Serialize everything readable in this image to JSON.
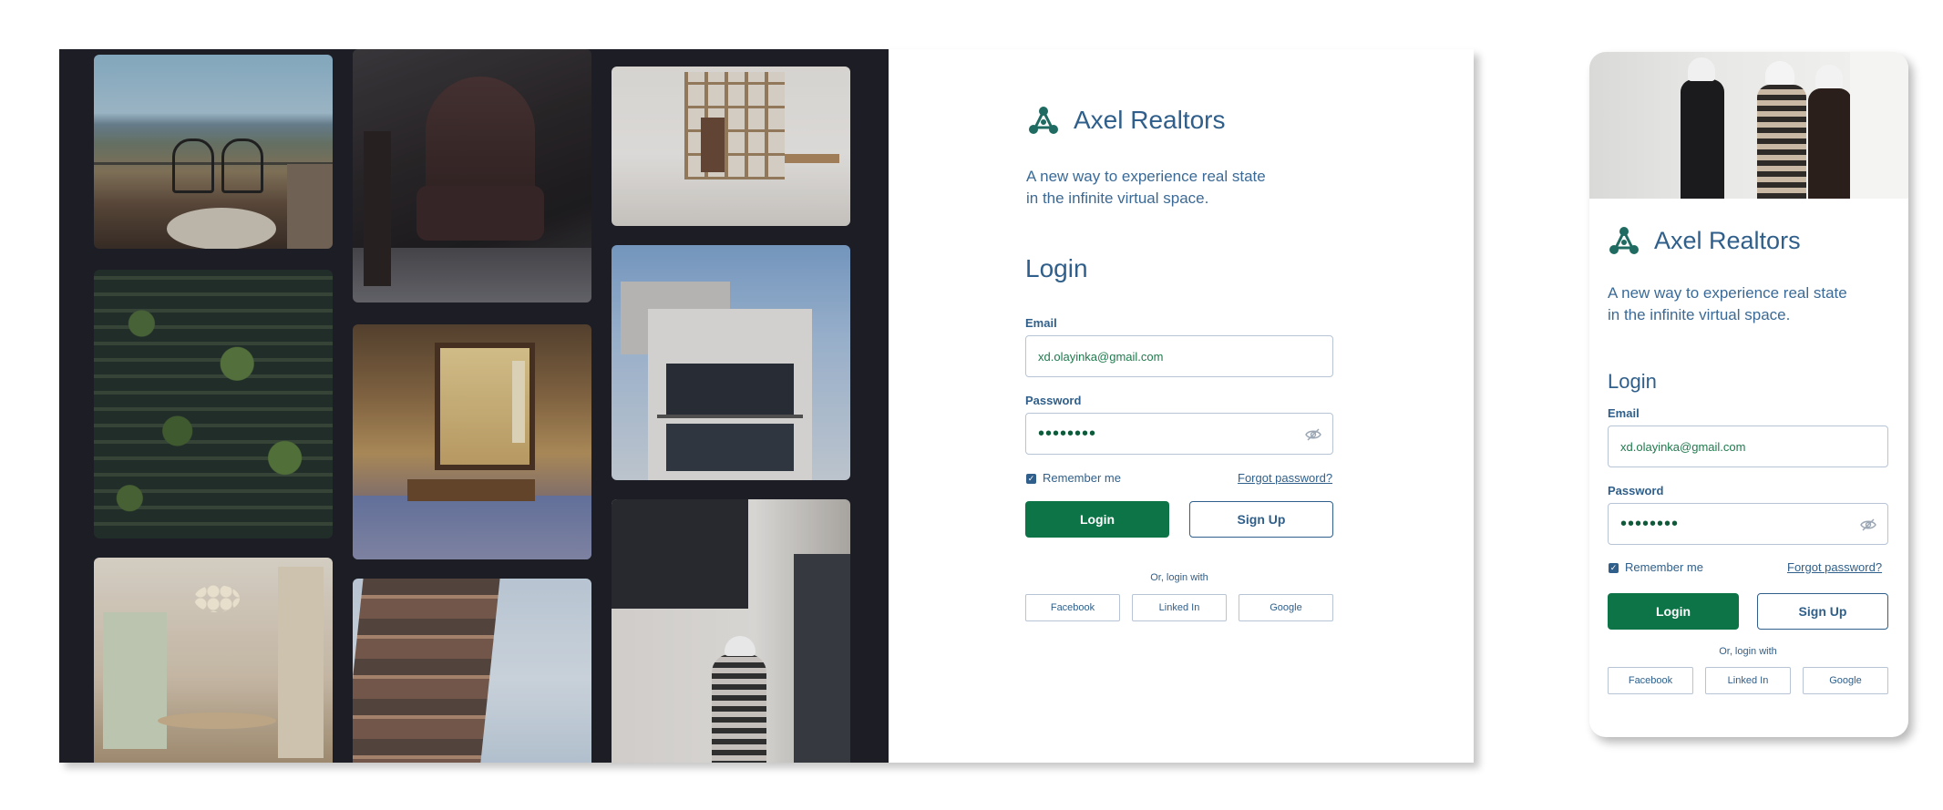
{
  "brand": {
    "name": "Axel Realtors",
    "tagline_line1": "A new way to experience real state",
    "tagline_line2": "in the infinite virtual space.",
    "accent_color": "#2f5f8a",
    "primary_color": "#0d7447"
  },
  "gallery": {
    "icon": "photo-collage",
    "photos": [
      "balcony-sea-view",
      "leather-armchair",
      "white-shelving-room",
      "vertical-forest-building",
      "japanese-tatami-room",
      "modern-house",
      "dining-room",
      "stacked-tower",
      "construction-worker"
    ]
  },
  "mobile_hero": {
    "icon": "team-in-hardhats-photo"
  },
  "form": {
    "title": "Login",
    "email_label": "Email",
    "email_value": "xd.olayinka@gmail.com",
    "password_label": "Password",
    "password_value": "••••••••",
    "password_toggle_icon": "eye-off-icon",
    "remember_label": "Remember me",
    "remember_checked": true,
    "forgot_label": "Forgot password?",
    "login_button": "Login",
    "signup_button": "Sign Up",
    "or_text": "Or, login with",
    "social": {
      "facebook": "Facebook",
      "linkedin": "Linked In",
      "google": "Google"
    }
  }
}
